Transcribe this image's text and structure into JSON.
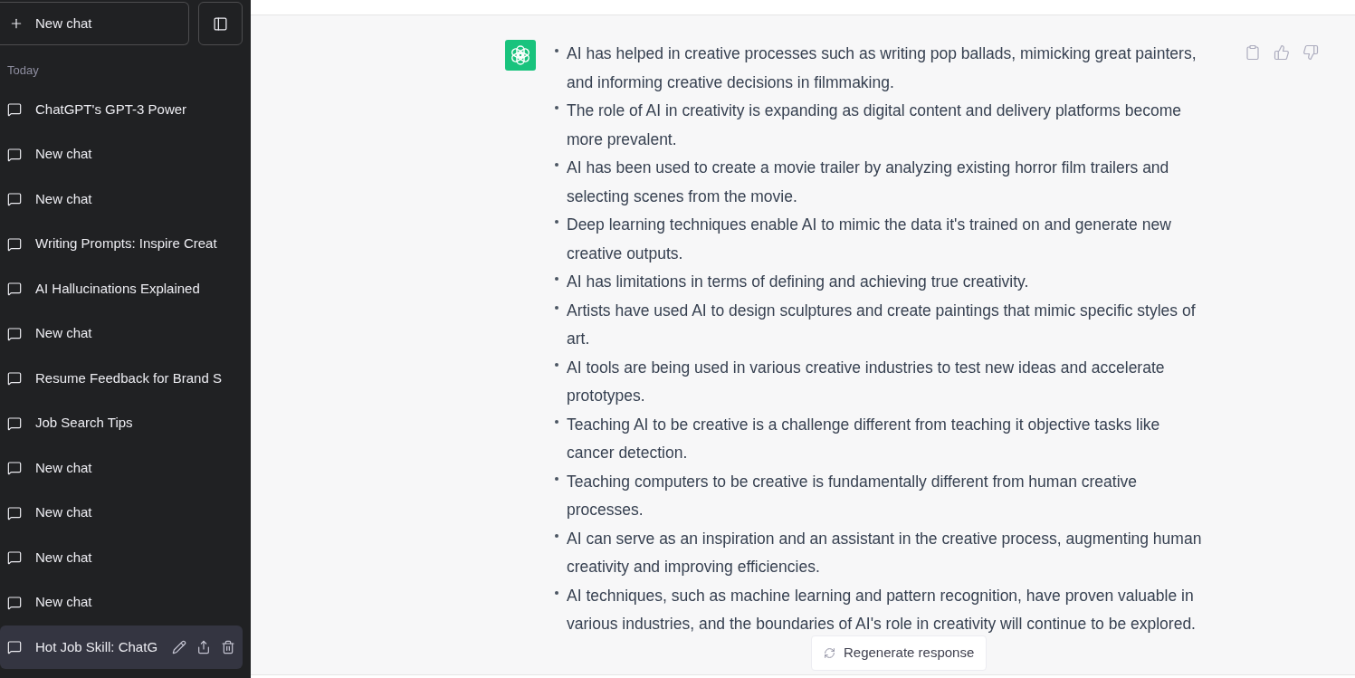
{
  "sidebar": {
    "new_chat_label": "New chat",
    "section_label": "Today",
    "chats": [
      {
        "title": "ChatGPT's GPT-3 Power",
        "selected": false
      },
      {
        "title": "New chat",
        "selected": false
      },
      {
        "title": "New chat",
        "selected": false
      },
      {
        "title": "Writing Prompts: Inspire Creat",
        "selected": false
      },
      {
        "title": "AI Hallucinations Explained",
        "selected": false
      },
      {
        "title": "New chat",
        "selected": false
      },
      {
        "title": "Resume Feedback for Brand S",
        "selected": false
      },
      {
        "title": "Job Search Tips",
        "selected": false
      },
      {
        "title": "New chat",
        "selected": false
      },
      {
        "title": "New chat",
        "selected": false
      },
      {
        "title": "New chat",
        "selected": false
      },
      {
        "title": "New chat",
        "selected": false
      },
      {
        "title": "Hot Job Skill: ChatG",
        "selected": true
      }
    ]
  },
  "message": {
    "bullets": [
      "AI has helped in creative processes such as writing pop ballads, mimicking great painters,\nand informing creative decisions in filmmaking.",
      "The role of AI in creativity is expanding as digital content and delivery platforms become\nmore prevalent.",
      "AI has been used to create a movie trailer by analyzing existing horror film trailers and\nselecting scenes from the movie.",
      "Deep learning techniques enable AI to mimic the data it's trained on and generate new\ncreative outputs.",
      "AI has limitations in terms of defining and achieving true creativity.",
      "Artists have used AI to design sculptures and create paintings that mimic specific styles of\nart.",
      "AI tools are being used in various creative industries to test new ideas and accelerate\nprototypes.",
      "Teaching AI to be creative is a challenge different from teaching it objective tasks like\ncancer detection.",
      "Teaching computers to be creative is fundamentally different from human creative\nprocesses.",
      "AI can serve as an inspiration and an assistant in the creative process, augmenting human\ncreativity and improving efficiencies.",
      "AI techniques, such as machine learning and pattern recognition, have proven valuable in\nvarious industries, and the boundaries of AI's role in creativity will continue to be explored."
    ]
  },
  "regenerate_label": "Regenerate response"
}
